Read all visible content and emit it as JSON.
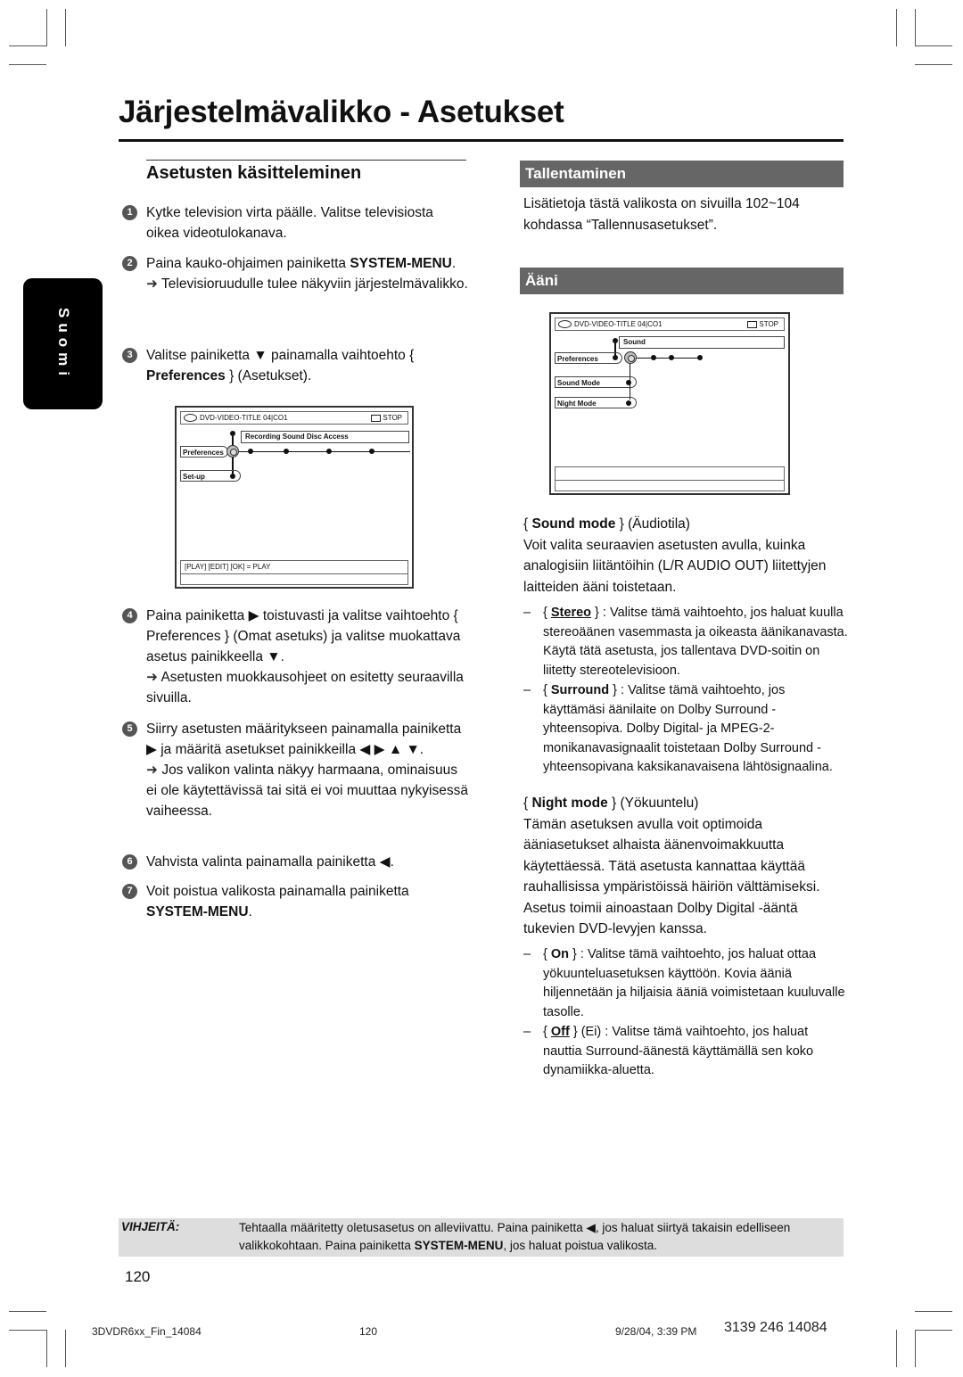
{
  "page": {
    "title": "Järjestelmävalikko - Asetukset",
    "language_tab": "Suomi",
    "page_number": "120"
  },
  "left": {
    "section_title": "Asetusten käsitteleminen",
    "steps": [
      {
        "num": "1",
        "text": "Kytke television virta päälle. Valitse televisiosta oikea videotulokanava."
      },
      {
        "num": "2",
        "pre": "Paina kauko-ohjaimen painiketta ",
        "bold": "SYSTEM-MENU",
        "post": ".",
        "result": "Televisioruudulle tulee näkyviin järjestelmävalikko."
      },
      {
        "num": "3",
        "pre": "Valitse painiketta ▼ painamalla vaihtoehto { ",
        "bold": "Preferences",
        "post": " } (Asetukset)."
      },
      {
        "num": "4",
        "text": "Paina painiketta ▶ toistuvasti ja valitse vaihtoehto { Preferences } (Omat asetuks) ja valitse muokattava asetus painikkeella ▼.",
        "result": "Asetusten muokkausohjeet on esitetty seuraavilla sivuilla."
      },
      {
        "num": "5",
        "text": "Siirry asetusten määritykseen painamalla painiketta ▶ ja määritä asetukset painikkeilla ◀ ▶ ▲ ▼.",
        "result": "Jos valikon valinta näkyy harmaana, ominaisuus ei ole käytettävissä tai sitä ei voi muuttaa nykyisessä vaiheessa."
      },
      {
        "num": "6",
        "text": "Vahvista valinta painamalla painiketta ◀."
      },
      {
        "num": "7",
        "pre": "Voit poistua valikosta painamalla painiketta ",
        "bold": "SYSTEM-MENU",
        "post": "."
      }
    ],
    "arrow_glyph": "➜"
  },
  "osd1": {
    "header": "DVD-VIDEO-TITLE 04|CO1",
    "status": "STOP",
    "menubar": "Recording  Sound  Disc  Access",
    "items": [
      "Preferences",
      "Set-up"
    ],
    "footer": "[PLAY] [EDIT] [OK] = PLAY"
  },
  "osd2": {
    "header": "DVD-VIDEO-TITLE 04|CO1",
    "status": "STOP",
    "menubar": "Sound",
    "items": [
      "Preferences",
      "Sound Mode",
      "Night Mode"
    ]
  },
  "right": {
    "recording": {
      "title": "Tallentaminen",
      "text": "Lisätietoja tästä valikosta on sivuilla 102~104 kohdassa “Tallennusasetukset”."
    },
    "sound": {
      "title": "Ääni",
      "sound_mode": {
        "label": "Sound mode",
        "translation": " } (Äudiotila)",
        "desc": "Voit valita seuraavien asetusten avulla, kuinka analogisiin liitäntöihin (L/R AUDIO OUT) liitettyjen laitteiden ääni toistetaan.",
        "options": [
          {
            "name": "Stereo",
            "default": true,
            "text": " } : Valitse tämä vaihtoehto, jos haluat kuulla stereoäänen vasemmasta ja oikeasta äänikanavasta. Käytä tätä asetusta, jos tallentava DVD-soitin on liitetty stereotelevisioon."
          },
          {
            "name": "Surround",
            "default": false,
            "text": " } : Valitse tämä vaihtoehto, jos käyttämäsi äänilaite on Dolby Surround -yhteensopiva. Dolby Digital- ja MPEG-2-monikanavasignaalit toistetaan Dolby Surround -yhteensopivana kaksikanavaisena lähtösignaalina."
          }
        ]
      },
      "night_mode": {
        "label": "Night mode",
        "translation": " } (Yökuuntelu)",
        "desc": "Tämän asetuksen avulla voit optimoida ääniasetukset alhaista äänenvoimakkuutta käytettäessä. Tätä asetusta kannattaa käyttää rauhallisissa ympäristöissä häiriön välttämiseksi. Asetus toimii ainoastaan Dolby Digital -ääntä tukevien DVD-levyjen kanssa.",
        "options": [
          {
            "name": "On",
            "default": false,
            "text": " } : Valitse tämä vaihtoehto, jos haluat ottaa yökuunteluasetuksen käyttöön. Kovia ääniä hiljennetään ja hiljaisia ääniä voimistetaan kuuluvalle tasolle."
          },
          {
            "name": "Off",
            "default": true,
            "text": " } (Ei) : Valitse tämä vaihtoehto, jos haluat nauttia Surround-äänestä käyttämällä sen koko dynamiikka-aluetta."
          }
        ]
      }
    }
  },
  "tip": {
    "label": "VIHJEITÄ:",
    "text_pre": "Tehtaalla määritetty oletusasetus on alleviivattu.  Paina painiketta ◀, jos haluat siirtyä takaisin edelliseen valikkokohtaan.  Paina painiketta ",
    "text_bold": "SYSTEM-MENU",
    "text_post": ", jos haluat poistua valikosta."
  },
  "footer": {
    "file": "3DVDR6xx_Fin_14084",
    "page": "120",
    "date": "9/28/04, 3:39 PM",
    "code": "3139 246 14084"
  }
}
